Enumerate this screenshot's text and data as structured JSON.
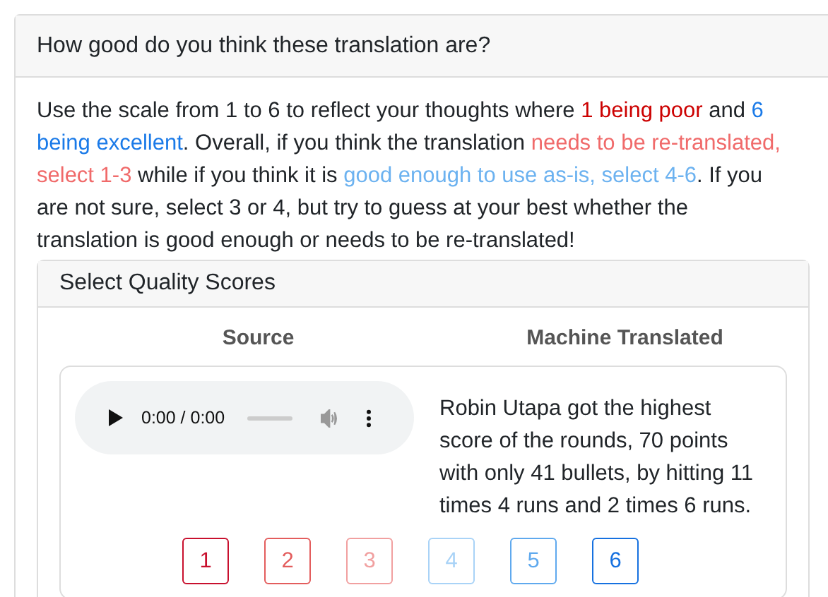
{
  "question": {
    "title": "How good do you think these translation are?"
  },
  "instructions": [
    {
      "text": "Use the scale from 1 to 6 to reflect your thoughts where "
    },
    {
      "text": "1 being poor",
      "color": "#cc0000"
    },
    {
      "text": " and "
    },
    {
      "text": "6 being excellent",
      "color": "#1a7ae8"
    },
    {
      "text": ". Overall, if you think the translation "
    },
    {
      "text": "needs to be re-translated, select 1-3",
      "color": "#f06a6a"
    },
    {
      "text": " while if you think it is "
    },
    {
      "text": "good enough to use as-is, select 4-6",
      "color": "#6cb2f0"
    },
    {
      "text": ". If you are not sure, select 3 or 4, but try to guess at your best whether the translation is good enough or needs to be re-translated!"
    }
  ],
  "scores_card": {
    "title": "Select Quality Scores",
    "columns": [
      "Source",
      "Machine Translated"
    ],
    "item": {
      "audio_time": "0:00 / 0:00",
      "translation": "Robin Utapa got the highest score of the rounds, 70 points with only 41 bullets, by hitting 11 times 4 runs and 2 times 6 runs.",
      "scores": [
        {
          "label": "1",
          "color": "#c8102e",
          "selected": false
        },
        {
          "label": "2",
          "color": "#e35d5d",
          "selected": false
        },
        {
          "label": "3",
          "color": "#f1a0a0",
          "selected": false
        },
        {
          "label": "4",
          "color": "#a9d3f7",
          "selected": false
        },
        {
          "label": "5",
          "color": "#5fa9ee",
          "selected": false
        },
        {
          "label": "6",
          "color": "#1671e0",
          "selected": false
        }
      ]
    }
  }
}
